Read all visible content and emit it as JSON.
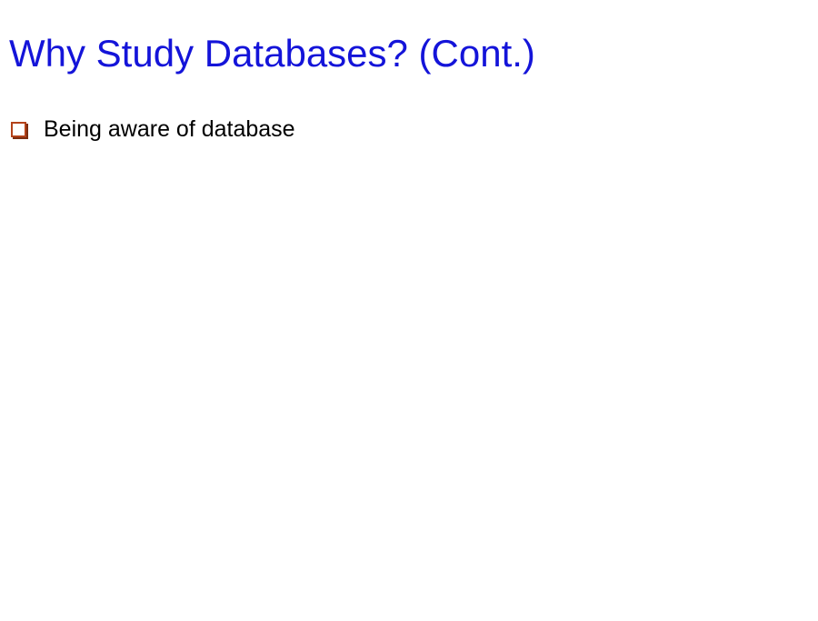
{
  "slide": {
    "title": "Why Study Databases? (Cont.)",
    "title_color": "#1414d9",
    "bullet_color": "#b3421a",
    "bullets": [
      {
        "icon": "square-bullet-icon",
        "text": "Being aware of database"
      }
    ]
  }
}
